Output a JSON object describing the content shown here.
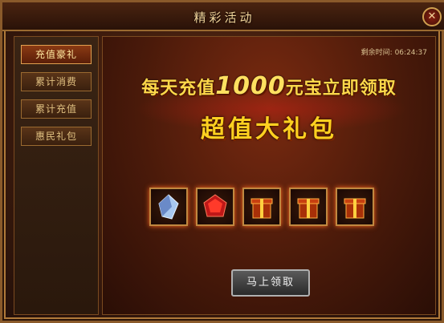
{
  "window": {
    "title": "精彩活动"
  },
  "sidebar": {
    "tabs": [
      {
        "label": "充值豪礼",
        "active": true
      },
      {
        "label": "累计消费",
        "active": false
      },
      {
        "label": "累计充值",
        "active": false
      },
      {
        "label": "惠民礼包",
        "active": false
      }
    ]
  },
  "main": {
    "timer_label": "剩余时间:",
    "timer_value": "06:24:37",
    "headline_prefix": "每天充值",
    "headline_amount": "1000",
    "headline_suffix": "元宝立即领取",
    "subtitle": "超值大礼包",
    "rewards": [
      {
        "icon": "crystal-icon"
      },
      {
        "icon": "red-gem-icon"
      },
      {
        "icon": "gift-box-icon"
      },
      {
        "icon": "gift-box-icon"
      },
      {
        "icon": "gift-box-icon"
      }
    ],
    "claim_button": "马上领取"
  },
  "colors": {
    "accent": "#ffd84a",
    "frame": "#9a6a30"
  }
}
